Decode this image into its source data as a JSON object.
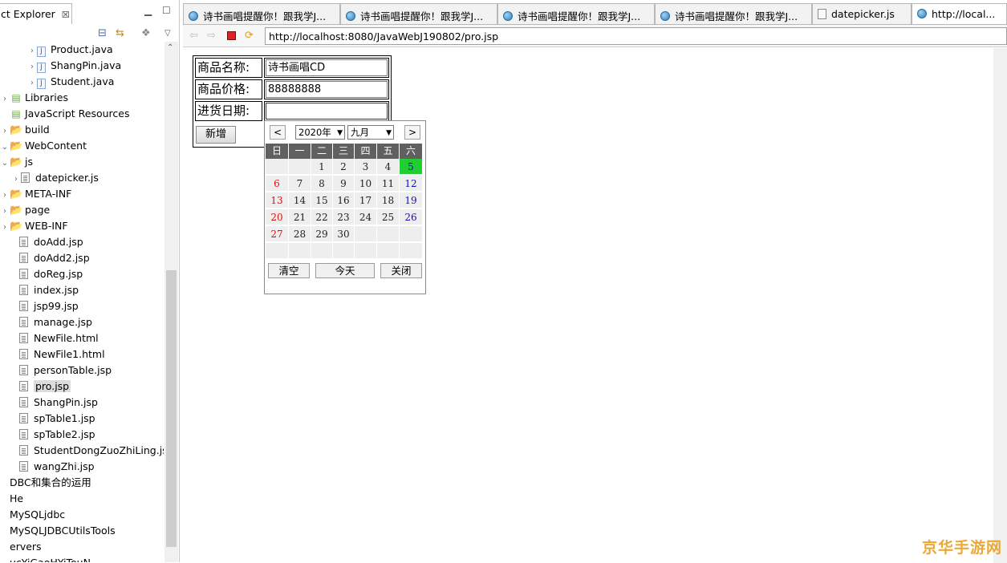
{
  "explorer": {
    "tab_label": "ct Explorer",
    "tab_close": "☒",
    "tree": [
      {
        "label": "Product.java",
        "icon": "java",
        "arrow": "›",
        "indent": 34
      },
      {
        "label": "ShangPin.java",
        "icon": "java",
        "arrow": "›",
        "indent": 34
      },
      {
        "label": "Student.java",
        "icon": "java",
        "arrow": "›",
        "indent": 34
      },
      {
        "label": "Libraries",
        "icon": "lib",
        "arrow": "›",
        "indent": 0
      },
      {
        "label": "JavaScript Resources",
        "icon": "lib",
        "arrow": "",
        "indent": 0
      },
      {
        "label": "build",
        "icon": "folder",
        "arrow": "›",
        "indent": 0
      },
      {
        "label": "WebContent",
        "icon": "folder",
        "arrow": "⌄",
        "indent": 0
      },
      {
        "label": "js",
        "icon": "folder",
        "arrow": "⌄",
        "indent": 0
      },
      {
        "label": "datepicker.js",
        "icon": "file",
        "arrow": "›",
        "indent": 14
      },
      {
        "label": "META-INF",
        "icon": "folder",
        "arrow": "›",
        "indent": 0
      },
      {
        "label": "page",
        "icon": "folder",
        "arrow": "›",
        "indent": 0
      },
      {
        "label": "WEB-INF",
        "icon": "folder",
        "arrow": "›",
        "indent": 0
      },
      {
        "label": "doAdd.jsp",
        "icon": "file",
        "arrow": "",
        "indent": 12
      },
      {
        "label": "doAdd2.jsp",
        "icon": "file",
        "arrow": "",
        "indent": 12
      },
      {
        "label": "doReg.jsp",
        "icon": "file",
        "arrow": "",
        "indent": 12
      },
      {
        "label": "index.jsp",
        "icon": "file",
        "arrow": "",
        "indent": 12
      },
      {
        "label": "jsp99.jsp",
        "icon": "file",
        "arrow": "",
        "indent": 12
      },
      {
        "label": "manage.jsp",
        "icon": "file",
        "arrow": "",
        "indent": 12
      },
      {
        "label": "NewFile.html",
        "icon": "file",
        "arrow": "",
        "indent": 12
      },
      {
        "label": "NewFile1.html",
        "icon": "file",
        "arrow": "",
        "indent": 12
      },
      {
        "label": "personTable.jsp",
        "icon": "file",
        "arrow": "",
        "indent": 12
      },
      {
        "label": "pro.jsp",
        "icon": "file",
        "arrow": "",
        "indent": 12,
        "selected": true
      },
      {
        "label": "ShangPin.jsp",
        "icon": "file",
        "arrow": "",
        "indent": 12
      },
      {
        "label": "spTable1.jsp",
        "icon": "file",
        "arrow": "",
        "indent": 12
      },
      {
        "label": "spTable2.jsp",
        "icon": "file",
        "arrow": "",
        "indent": 12
      },
      {
        "label": "StudentDongZuoZhiLing.jsp",
        "icon": "file",
        "arrow": "",
        "indent": 12
      },
      {
        "label": "wangZhi.jsp",
        "icon": "file",
        "arrow": "",
        "indent": 12
      },
      {
        "label": "DBC和集合的运用",
        "icon": "",
        "arrow": "",
        "indent": 0
      },
      {
        "label": "He",
        "icon": "",
        "arrow": "",
        "indent": 0
      },
      {
        "label": "MySQLjdbc",
        "icon": "",
        "arrow": "",
        "indent": 0
      },
      {
        "label": "MySQLJDBCUtilsTools",
        "icon": "",
        "arrow": "",
        "indent": 0
      },
      {
        "label": "ervers",
        "icon": "",
        "arrow": "",
        "indent": 0
      },
      {
        "label": "ucYiGaoHYiTouN...",
        "icon": "",
        "arrow": "",
        "indent": 0
      }
    ]
  },
  "tabs": [
    {
      "label": "诗书画唱提醒你！跟我学J...",
      "icon": "globe"
    },
    {
      "label": "诗书画唱提醒你！跟我学J...",
      "icon": "globe"
    },
    {
      "label": "诗书画唱提醒你！跟我学J...",
      "icon": "globe"
    },
    {
      "label": "诗书画唱提醒你！跟我学J...",
      "icon": "globe"
    },
    {
      "label": "datepicker.js",
      "icon": "js"
    },
    {
      "label": "http://local...",
      "icon": "globe",
      "active": true
    }
  ],
  "browser": {
    "url": "http://localhost:8080/JavaWebJ190802/pro.jsp"
  },
  "form": {
    "name_label": "商品名称:",
    "name_value": "诗书画唱CD",
    "price_label": "商品价格:",
    "price_value": "88888888",
    "date_label": "进货日期:",
    "date_value": "",
    "submit_label": "新增"
  },
  "datepicker": {
    "prev": "<",
    "next": ">",
    "year": "2020年",
    "month": "九月",
    "weekdays": [
      "日",
      "一",
      "二",
      "三",
      "四",
      "五",
      "六"
    ],
    "weeks": [
      [
        "",
        "",
        "1",
        "2",
        "3",
        "4",
        "5"
      ],
      [
        "6",
        "7",
        "8",
        "9",
        "10",
        "11",
        "12"
      ],
      [
        "13",
        "14",
        "15",
        "16",
        "17",
        "18",
        "19"
      ],
      [
        "20",
        "21",
        "22",
        "23",
        "24",
        "25",
        "26"
      ],
      [
        "27",
        "28",
        "29",
        "30",
        "",
        "",
        ""
      ],
      [
        "",
        "",
        "",
        "",
        "",
        "",
        ""
      ]
    ],
    "today": "5",
    "clear_label": "清空",
    "today_label": "今天",
    "close_label": "关闭",
    "colors": {
      "today_bg": "#22cc33",
      "sunday": "#dd1111",
      "saturday": "#1111bb",
      "header_bg": "#606060"
    }
  },
  "watermark": "京华手游网"
}
